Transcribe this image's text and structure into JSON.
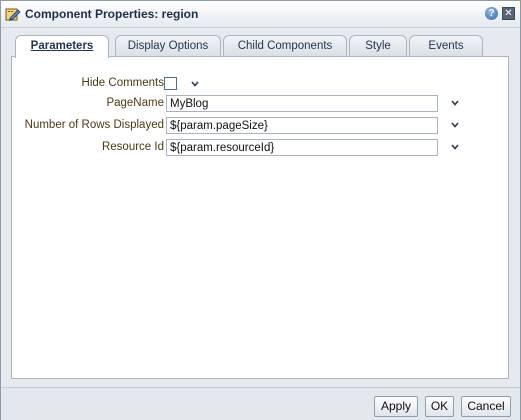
{
  "dialog": {
    "title": "Component Properties: region",
    "help_glyph": "?",
    "close_glyph": "✕"
  },
  "tabs": [
    {
      "label": "Parameters",
      "active": true
    },
    {
      "label": "Display Options",
      "active": false
    },
    {
      "label": "Child Components",
      "active": false
    },
    {
      "label": "Style",
      "active": false
    },
    {
      "label": "Events",
      "active": false
    }
  ],
  "parameters": {
    "hide_comments": {
      "label": "Hide Comments",
      "checked": false
    },
    "page_name": {
      "label": "PageName",
      "value": "MyBlog"
    },
    "rows_displayed": {
      "label": "Number of Rows Displayed",
      "value": "${param.pageSize}"
    },
    "resource_id": {
      "label": "Resource Id",
      "value": "${param.resourceId}"
    }
  },
  "footer": {
    "apply_label": "Apply",
    "ok_label": "OK",
    "cancel_label": "Cancel"
  },
  "colors": {
    "label_text": "#4d3b10",
    "title_text": "#1d2f47",
    "tab_text": "#1f3552",
    "panel_border": "#a9b5c2"
  },
  "icons": {
    "title": "edit-pencil-icon",
    "help": "help-icon",
    "close": "close-icon",
    "dropdown": "chevron-down-icon"
  }
}
